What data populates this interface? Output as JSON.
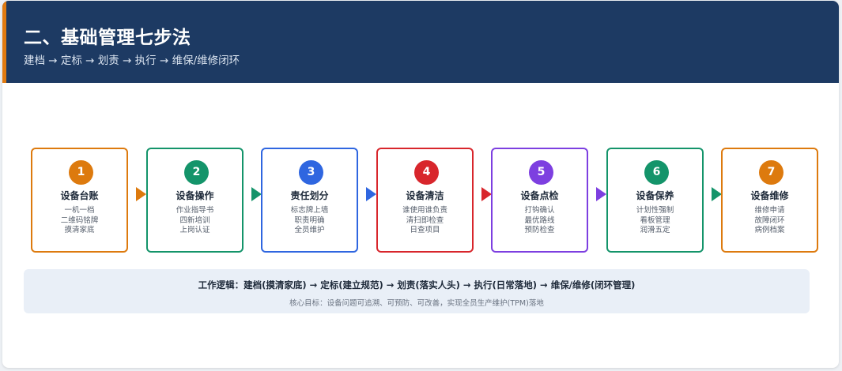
{
  "header": {
    "title": "二、基础管理七步法",
    "subtitle": "建档 → 定标 → 划责 → 执行 → 维保/维修闭环"
  },
  "colors": {
    "header_bg": "#1d3a63",
    "header_accent": "#e07a10",
    "logic_bg": "#e9eff7"
  },
  "steps": [
    {
      "number": "1",
      "title": "设备台账",
      "lines": [
        "一机一档",
        "二维码铭牌",
        "摸清家底"
      ],
      "color": "#dd7a0e"
    },
    {
      "number": "2",
      "title": "设备操作",
      "lines": [
        "作业指导书",
        "四新培训",
        "上岗认证"
      ],
      "color": "#14946a"
    },
    {
      "number": "3",
      "title": "责任划分",
      "lines": [
        "标志牌上墙",
        "职责明确",
        "全员维护"
      ],
      "color": "#2f66e0"
    },
    {
      "number": "4",
      "title": "设备清洁",
      "lines": [
        "谁使用谁负责",
        "清扫即检查",
        "日查项目"
      ],
      "color": "#d8262c"
    },
    {
      "number": "5",
      "title": "设备点检",
      "lines": [
        "打钩确认",
        "最优路线",
        "预防检查"
      ],
      "color": "#7d3fe0"
    },
    {
      "number": "6",
      "title": "设备保养",
      "lines": [
        "计划性强制",
        "看板管理",
        "润滑五定"
      ],
      "color": "#14946a"
    },
    {
      "number": "7",
      "title": "设备维修",
      "lines": [
        "维修申请",
        "故障闭环",
        "病例档案"
      ],
      "color": "#dd7a0e"
    }
  ],
  "logic": {
    "main": "工作逻辑：建档(摸清家底) → 定标(建立规范) → 划责(落实人头) → 执行(日常落地) → 维保/维修(闭环管理)",
    "sub": "核心目标：设备问题可追溯、可预防、可改善，实现全员生产维护(TPM)落地"
  }
}
